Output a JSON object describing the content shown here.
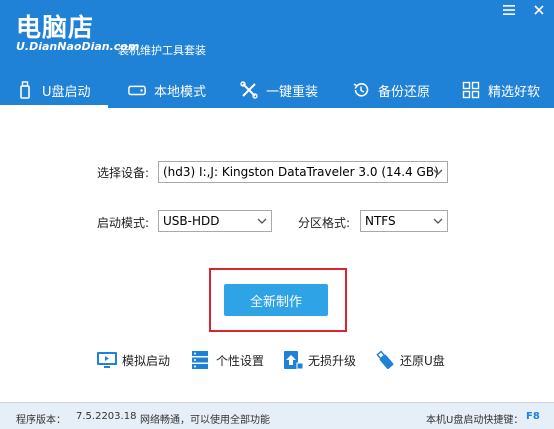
{
  "header": {
    "logo_main": "电脑店",
    "logo_url": "U.DianNaoDian.com",
    "subtitle": "装机维护工具套装",
    "menu_icon": "hamburger-menu-icon",
    "close_icon": "close-icon"
  },
  "tabs": [
    {
      "label": "U盘启动",
      "icon": "usb-drive-icon",
      "active": true
    },
    {
      "label": "本地模式",
      "icon": "hard-disk-icon",
      "active": false
    },
    {
      "label": "一键重装",
      "icon": "tools-icon",
      "active": false
    },
    {
      "label": "备份还原",
      "icon": "history-restore-icon",
      "active": false
    },
    {
      "label": "精选好软",
      "icon": "apps-grid-icon",
      "active": false
    }
  ],
  "form": {
    "device_label": "选择设备:",
    "device_value": "(hd3) I:,J: Kingston DataTraveler 3.0 (14.4 GB)",
    "boot_mode_label": "启动模式:",
    "boot_mode_value": "USB-HDD",
    "partition_label": "分区格式:",
    "partition_value": "NTFS"
  },
  "make_button": "全新制作",
  "tools": [
    {
      "label": "模拟启动",
      "icon": "monitor-icon"
    },
    {
      "label": "个性设置",
      "icon": "server-settings-icon"
    },
    {
      "label": "无损升级",
      "icon": "upgrade-icon"
    },
    {
      "label": "还原U盘",
      "icon": "usb-restore-icon"
    }
  ],
  "footer": {
    "version_label": "程序版本：",
    "version_value": "7.5.2203.18",
    "network_status": "网络畅通，可以使用全部功能",
    "hotkey_label": "本机U盘启动快捷键：",
    "hotkey_value": "F8"
  },
  "colors": {
    "header_blue": "#1f82d6",
    "button_blue": "#2ea3e6",
    "highlight_red": "#d9252b"
  }
}
